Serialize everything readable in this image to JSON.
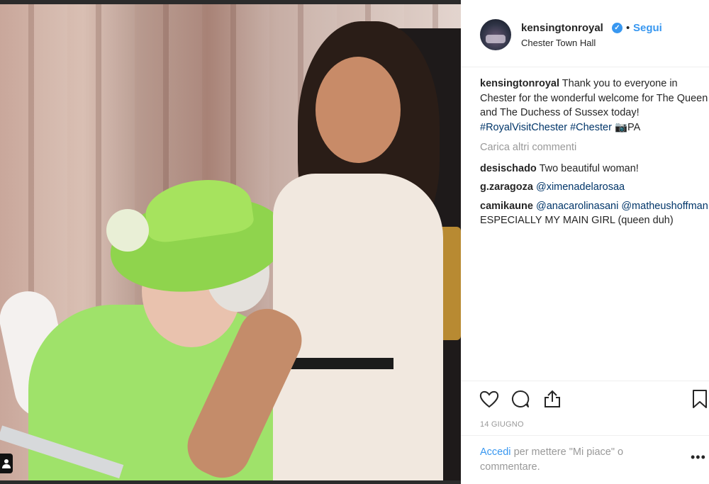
{
  "post": {
    "username": "kensingtonroyal",
    "follow_label": "Segui",
    "separator": "•",
    "location": "Chester Town Hall",
    "verified_mark": "✓"
  },
  "caption": {
    "username": "kensingtonroyal",
    "text_1": "Thank you to everyone in Chester for the wonderful welcome for The Queen and The Duchess of Sussex today! ",
    "hashtag_1": "#RoyalVisitChester",
    "hashtag_2": "#Chester",
    "camera_emoji": "📷",
    "credit": "PA"
  },
  "load_more": "Carica altri commenti",
  "comments": [
    {
      "user": "desischado",
      "text": "Two beautiful woman!"
    },
    {
      "user": "g.zaragoza",
      "mention": "@ximenadelarosaa"
    },
    {
      "user": "camikaune",
      "mention_1": "@anacarolinasani",
      "mention_2": "@matheushoffman",
      "text": "ESPECIALLY MY MAIN GIRL (queen duh)"
    }
  ],
  "icons": [
    "heart-icon",
    "comment-icon",
    "share-icon",
    "bookmark-icon"
  ],
  "date": "14 GIUGNO",
  "login": {
    "link": "Accedi",
    "text": "per mettere \"Mi piace\" o commentare."
  },
  "more_label": "•••",
  "colors": {
    "link": "#3897f0",
    "text": "#262626",
    "muted": "#999999"
  }
}
